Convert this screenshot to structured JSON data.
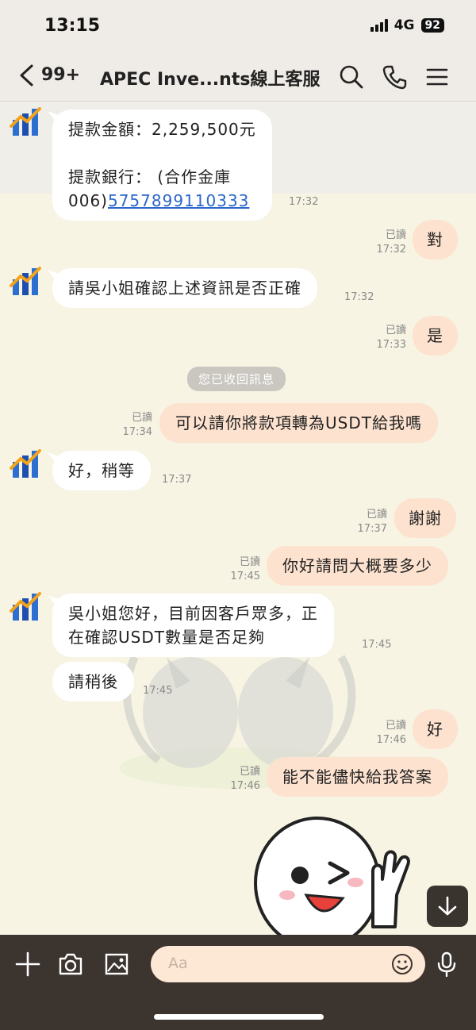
{
  "status_bar": {
    "time": "13:15",
    "network": "4G",
    "battery": "92"
  },
  "header": {
    "unread_count": "99+",
    "title": "APEC Inve...nts線上客服"
  },
  "messages": {
    "m1": {
      "line1": "提款金額：2,259,500元",
      "line3": "提款銀行：  (合作金庫",
      "line4_prefix": "006)",
      "line4_link": "5757899110333",
      "time": "17:32"
    },
    "m2": {
      "text": "對",
      "read": "已讀",
      "time": "17:32"
    },
    "m3": {
      "text": "請吳小姐確認上述資訊是否正確",
      "time": "17:32"
    },
    "m4": {
      "text": "是",
      "read": "已讀",
      "time": "17:33"
    },
    "recall": "您已收回訊息",
    "m5": {
      "text": "可以請你將款項轉為USDT給我嗎",
      "read": "已讀",
      "time": "17:34"
    },
    "m6": {
      "text": "好，稍等",
      "time": "17:37"
    },
    "m7": {
      "text": "謝謝",
      "read": "已讀",
      "time": "17:37"
    },
    "m8": {
      "text": "你好請問大概要多少",
      "read": "已讀",
      "time": "17:45"
    },
    "m9": {
      "line1": "吳小姐您好，目前因客戶眾多，正",
      "line2": "在確認USDT數量是否足夠",
      "time": "17:45"
    },
    "m10": {
      "text": "請稍後",
      "time": "17:45"
    },
    "m11": {
      "text": "好",
      "read": "已讀",
      "time": "17:46"
    },
    "m12": {
      "text": "能不能儘快給我答案",
      "read": "已讀",
      "time": "17:46"
    }
  },
  "input": {
    "placeholder": "Aa"
  },
  "colors": {
    "incoming_bubble": "#ffffff",
    "outgoing_bubble": "#fde2cf",
    "link": "#2a66c9",
    "bottom_bar": "#3b342f"
  },
  "icons": [
    "back-chevron-icon",
    "search-icon",
    "phone-icon",
    "menu-icon",
    "plus-icon",
    "camera-icon",
    "image-icon",
    "emoji-icon",
    "microphone-icon",
    "arrow-down-icon"
  ]
}
